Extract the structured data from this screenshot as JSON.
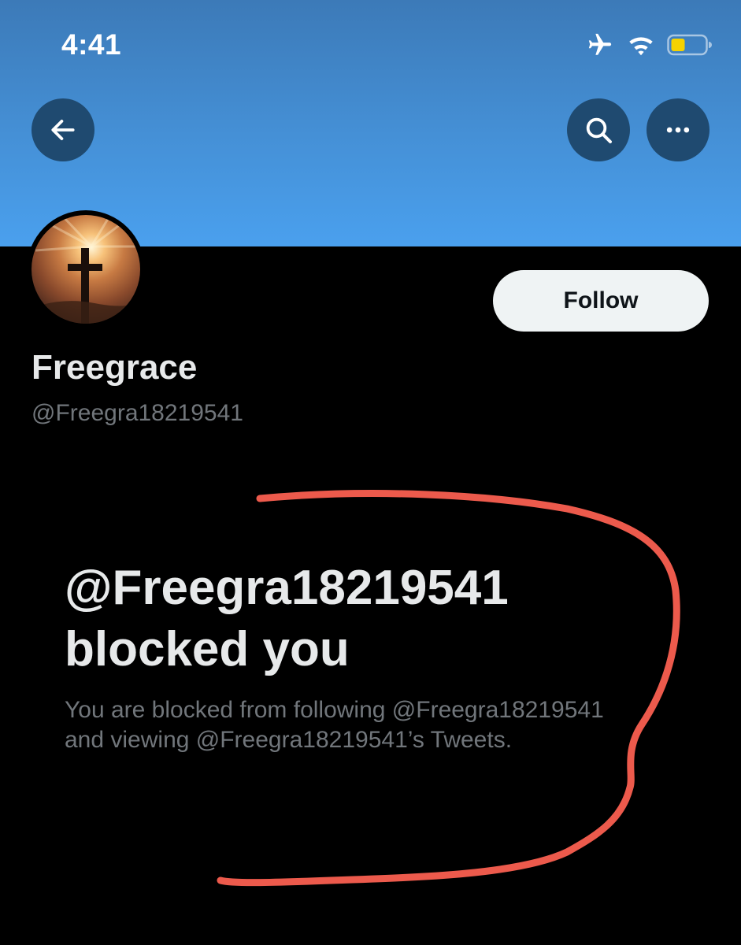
{
  "status_bar": {
    "time": "4:41",
    "icons": [
      "airplane-icon",
      "wifi-icon",
      "battery-icon"
    ],
    "battery_color": "#f5d200"
  },
  "nav": {
    "back_icon": "arrow-left-icon",
    "search_icon": "search-icon",
    "more_icon": "more-horizontal-icon"
  },
  "profile": {
    "display_name": "Freegrace",
    "handle": "@Freegra18219541",
    "follow_label": "Follow",
    "avatar_icon": "cross-sunset-avatar"
  },
  "blocked": {
    "title_line1": "@Freegra18219541",
    "title_line2": "blocked you",
    "desc_line1": "You are blocked from following @Freegra18219541",
    "desc_line2": "and viewing @Freegra18219541’s Tweets."
  },
  "colors": {
    "banner": "#4590d6",
    "background": "#000000",
    "follow_bg": "#eff3f4",
    "annotation": "#ec5a4c"
  }
}
